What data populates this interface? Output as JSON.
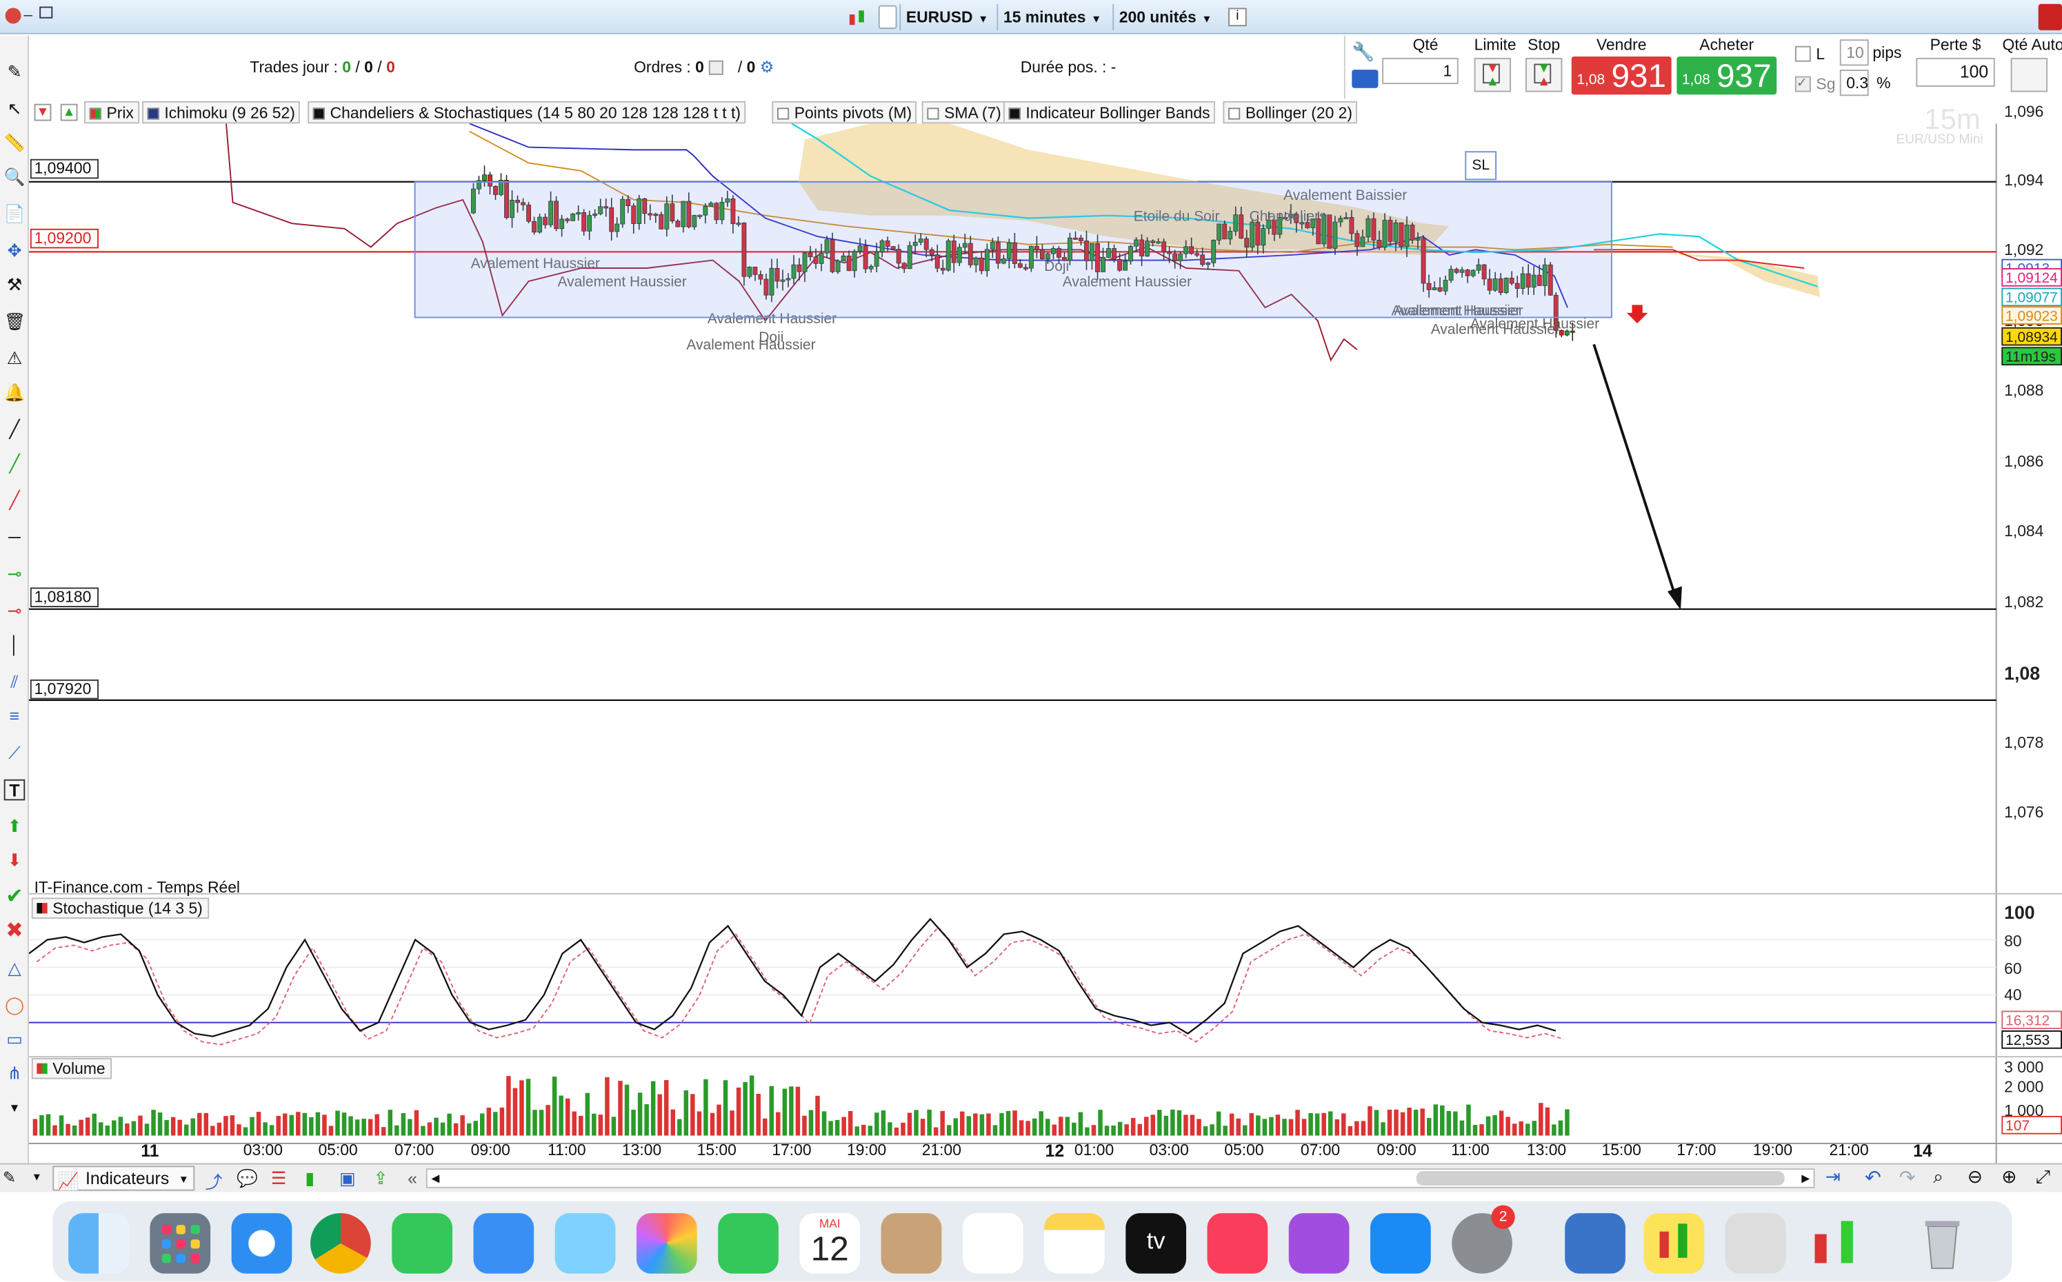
{
  "topbar": {
    "symbol": "EURUSD",
    "timeframe": "15 minutes",
    "units": "200 unités"
  },
  "infobar": {
    "trades_label": "Trades jour :",
    "trades_a": "0",
    "trades_sep1": "/",
    "trades_b": "0",
    "trades_sep2": "/",
    "trades_c": "0",
    "orders_label": "Ordres :",
    "orders_a": "0",
    "orders_sep": "/",
    "orders_b": "0",
    "duration_label": "Durée pos. :",
    "duration_value": "-"
  },
  "orderpanel": {
    "qty_label": "Qté",
    "qty_value": "1",
    "limit_label": "Limite",
    "stop_label": "Stop",
    "sell_label": "Vendre",
    "sell_small": "1,08",
    "sell_big": "931",
    "buy_label": "Acheter",
    "buy_small": "1,08",
    "buy_big": "937",
    "l_label": "L",
    "pips_value": "10",
    "pips_label": "pips",
    "sg_label": "Sg",
    "pct_value": "0.3",
    "pct_label": "%",
    "loss_label": "Perte $",
    "loss_value": "100",
    "qtyauto_label": "Qté Auto"
  },
  "tabs": {
    "prix": "Prix",
    "ichimoku": "Ichimoku (9 26 52)",
    "chandeliers": "Chandeliers & Stochastiques (14 5 80 20 128 128 128 t t t)",
    "pivots": "Points pivots (M)",
    "sma": "SMA (7)",
    "bollinger_ind": "Indicateur Bollinger Bands",
    "bollinger": "Bollinger (20 2)"
  },
  "chart": {
    "watermark_tf": "15m",
    "watermark_sym": "EUR/USD Mini",
    "source": "IT-Finance.com - Temps Réel",
    "sl_label": "SL",
    "level_labels": [
      "1,09400",
      "1,09200",
      "1,08180",
      "1,07920"
    ],
    "patterns": [
      "Avalement Haussier",
      "Avalement Haussier",
      "Avalement Haussier",
      "Doji",
      "Avalement Haussier",
      "Doji",
      "Avalement Haussier",
      "Avalement Haussier",
      "Avalement Haussier",
      "Avalement Baissier",
      "Avalement Haussier",
      "Avalement Haussier",
      "Etoile du Soir",
      "Chandeliers"
    ]
  },
  "price_axis": {
    "ticks": [
      "1,096",
      "1,094",
      "1,092",
      "1,090",
      "1,088",
      "1,086",
      "1,084",
      "1,082",
      "1,08",
      "1,078",
      "1,076"
    ],
    "tags": [
      {
        "text": "1,0913",
        "color": "#3b5bd6"
      },
      {
        "text": "1,09124",
        "color": "#e0207a"
      },
      {
        "text": "1,09077",
        "color": "#1aa7b5"
      },
      {
        "text": "1,09023",
        "color": "#d88a1b"
      },
      {
        "text": "1,08934",
        "color": "#222222"
      },
      {
        "text": "11m19s",
        "color": "#222222"
      }
    ]
  },
  "stochastic": {
    "label": "Stochastique (14 3 5)",
    "ticks": [
      "100",
      "80",
      "60",
      "40"
    ],
    "tag_a": "16,312",
    "tag_b": "12,553"
  },
  "volume": {
    "label": "Volume",
    "ticks": [
      "3 000",
      "2 000",
      "1 000"
    ],
    "tag": "107"
  },
  "time_axis": {
    "labels": [
      "11",
      "03:00",
      "05:00",
      "07:00",
      "09:00",
      "11:00",
      "13:00",
      "15:00",
      "17:00",
      "19:00",
      "21:00",
      "12",
      "01:00",
      "03:00",
      "05:00",
      "07:00",
      "09:00",
      "11:00",
      "13:00",
      "15:00",
      "17:00",
      "19:00",
      "21:00",
      "14"
    ]
  },
  "bottombar": {
    "indicators_label": "Indicateurs"
  },
  "dock": {
    "calendar_month": "MAI",
    "calendar_day": "12",
    "tv_label": "tv",
    "settings_badge": "2"
  },
  "colors": {
    "sell": "#e03a3a",
    "buy": "#2fb14a",
    "resistance": "#e02020",
    "cloud": "#f3d9a0",
    "stoch_k": "#111111",
    "stoch_d": "#e06070"
  }
}
